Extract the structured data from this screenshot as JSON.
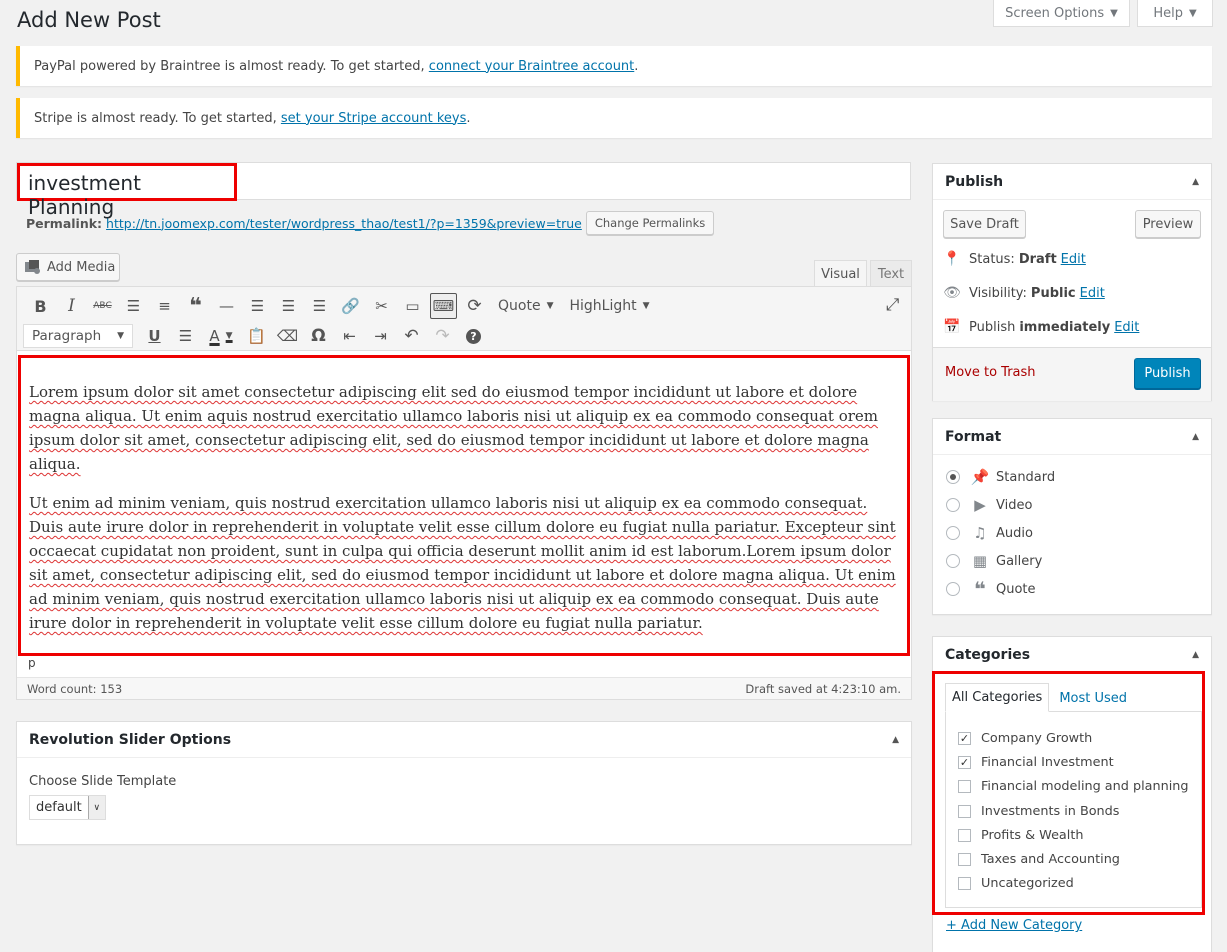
{
  "header": {
    "title": "Add New Post",
    "screen_options": "Screen Options",
    "help": "Help"
  },
  "notices": [
    {
      "text": "PayPal powered by Braintree is almost ready. To get started,",
      "link": "connect your Braintree account",
      "end": "."
    },
    {
      "text": "Stripe is almost ready. To get started,",
      "link": "set your Stripe account keys",
      "end": "."
    }
  ],
  "post": {
    "title": "investment Planning",
    "permalink_label": "Permalink:",
    "permalink_url": "http://tn.joomexp.com/tester/wordpress_thao/test1/?p=1359&preview=true",
    "change_permalinks": "Change Permalinks"
  },
  "editor": {
    "add_media": "Add Media",
    "tab_visual": "Visual",
    "tab_text": "Text",
    "quote_label": "Quote",
    "highlight_label": "HighLight",
    "format_select": "Paragraph",
    "paragraphs": [
      "Lorem ipsum dolor sit amet consectetur adipiscing elit sed do eiusmod tempor incididunt ut labore et dolore magna aliqua. Ut enim aquis nostrud exercitatio ullamco laboris nisi ut aliquip ex ea commodo consequat orem ipsum dolor sit amet, consectetur adipiscing elit, sed do eiusmod tempor incididunt ut labore et dolore magna aliqua.",
      "Ut enim ad minim veniam, quis nostrud exercitation ullamco laboris nisi ut aliquip ex ea commodo consequat. Duis aute irure dolor in reprehenderit in voluptate velit esse cillum dolore eu fugiat nulla pariatur. Excepteur sint occaecat cupidatat non proident, sunt in culpa qui officia deserunt mollit anim id est laborum.Lorem ipsum dolor sit amet, consectetur adipiscing elit, sed do eiusmod tempor incididunt ut labore et dolore magna aliqua. Ut enim ad minim veniam, quis nostrud exercitation ullamco laboris nisi ut aliquip ex ea commodo consequat. Duis aute irure dolor in reprehenderit in voluptate velit esse cillum dolore eu fugiat nulla pariatur."
    ],
    "path": "p",
    "word_count": "Word count: 153",
    "draft_saved": "Draft saved at 4:23:10 am."
  },
  "revslider": {
    "title": "Revolution Slider Options",
    "choose_label": "Choose Slide Template",
    "selected": "default"
  },
  "publish": {
    "title": "Publish",
    "save_draft": "Save Draft",
    "preview": "Preview",
    "status_label": "Status:",
    "status_value": "Draft",
    "visibility_label": "Visibility:",
    "visibility_value": "Public",
    "publish_label": "Publish",
    "publish_value": "immediately",
    "edit": "Edit",
    "trash": "Move to Trash",
    "publish_button": "Publish",
    "trash_color": "#a00"
  },
  "format": {
    "title": "Format",
    "options": [
      {
        "label": "Standard",
        "icon": "pin-icon",
        "selected": true
      },
      {
        "label": "Video",
        "icon": "video-icon",
        "selected": false
      },
      {
        "label": "Audio",
        "icon": "audio-icon",
        "selected": false
      },
      {
        "label": "Gallery",
        "icon": "gallery-icon",
        "selected": false
      },
      {
        "label": "Quote",
        "icon": "quote-icon",
        "selected": false
      }
    ]
  },
  "categories": {
    "title": "Categories",
    "tab_all": "All Categories",
    "tab_most": "Most Used",
    "items": [
      {
        "label": "Company Growth",
        "checked": true
      },
      {
        "label": "Financial Investment",
        "checked": true
      },
      {
        "label": "Financial modeling and planning",
        "checked": false
      },
      {
        "label": "Investments in Bonds",
        "checked": false
      },
      {
        "label": "Profits & Wealth",
        "checked": false
      },
      {
        "label": "Taxes and Accounting",
        "checked": false
      },
      {
        "label": "Uncategorized",
        "checked": false
      }
    ],
    "add_new": "+ Add New Category"
  }
}
